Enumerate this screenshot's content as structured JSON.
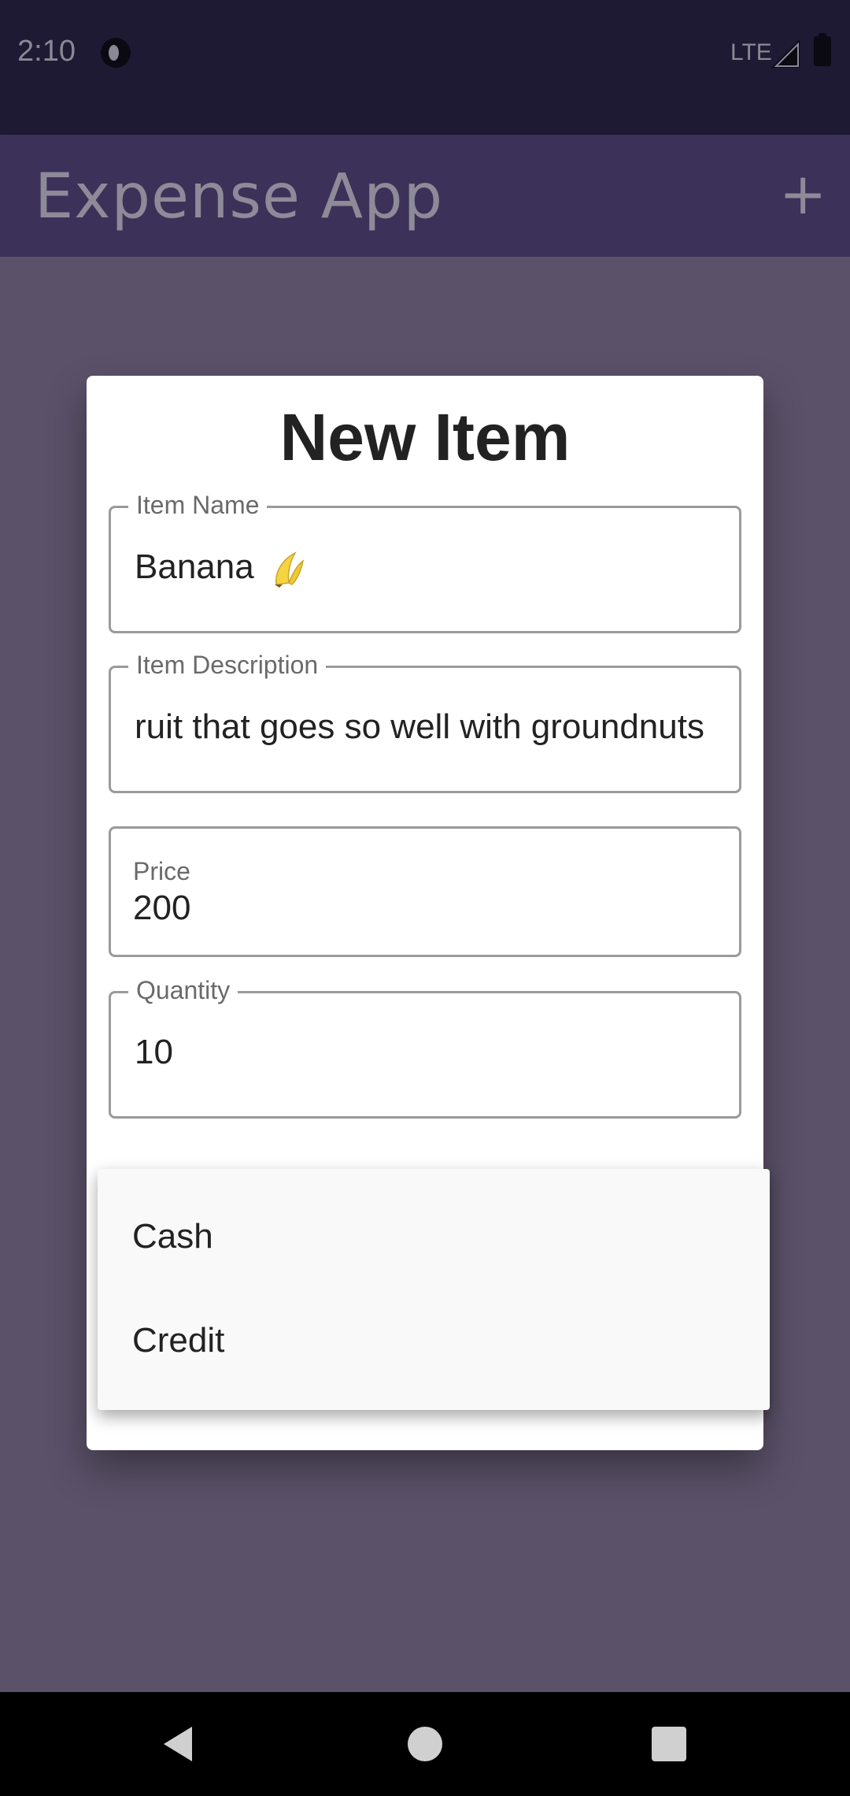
{
  "status_bar": {
    "time": "2:10",
    "network": "LTE"
  },
  "app_bar": {
    "title": "Expense App",
    "add_icon": "+"
  },
  "dialog": {
    "title": "New Item",
    "item_name": {
      "label": "Item Name",
      "value": "Banana",
      "emoji": "banana-emoji"
    },
    "item_description": {
      "label": "Item Description",
      "value": "ruit that goes so well with groundnuts"
    },
    "price": {
      "label": "Price",
      "value": "200"
    },
    "quantity": {
      "label": "Quantity",
      "value": "10"
    }
  },
  "payment_dropdown": {
    "options": [
      "Cash",
      "Credit"
    ]
  },
  "colors": {
    "app_bar": "#3b3159",
    "scrim": "#5b5169",
    "accent": "#6f5a9a"
  }
}
